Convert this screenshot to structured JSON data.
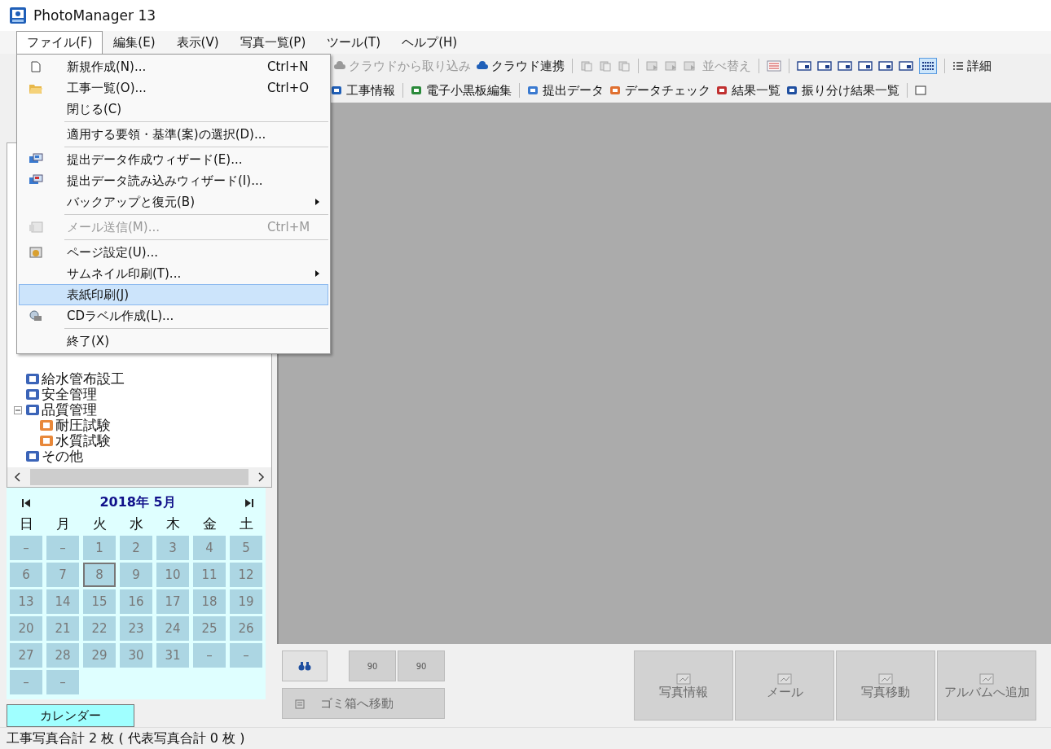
{
  "window": {
    "title": "PhotoManager 13"
  },
  "menubar": [
    {
      "label": "ファイル(F)",
      "selected": true
    },
    {
      "label": "編集(E)",
      "selected": false
    },
    {
      "label": "表示(V)",
      "selected": false
    },
    {
      "label": "写真一覧(P)",
      "selected": false
    },
    {
      "label": "ツール(T)",
      "selected": false
    },
    {
      "label": "ヘルプ(H)",
      "selected": false
    }
  ],
  "file_menu": {
    "groups": [
      [
        {
          "label": "新規作成(N)...",
          "shortcut": "Ctrl+N",
          "disabled": false,
          "selected": false,
          "submenu": false
        },
        {
          "label": "工事一覧(O)...",
          "shortcut": "Ctrl+O",
          "disabled": false,
          "selected": false,
          "submenu": false
        },
        {
          "label": "閉じる(C)",
          "disabled": false,
          "selected": false,
          "submenu": false
        }
      ],
      [
        {
          "label": "適用する要領・基準(案)の選択(D)...",
          "disabled": false,
          "selected": false,
          "submenu": false
        }
      ],
      [
        {
          "label": "提出データ作成ウィザード(E)...",
          "disabled": false,
          "selected": false,
          "submenu": false
        },
        {
          "label": "提出データ読み込みウィザード(I)...",
          "disabled": false,
          "selected": false,
          "submenu": false
        },
        {
          "label": "バックアップと復元(B)",
          "disabled": false,
          "selected": false,
          "submenu": true
        }
      ],
      [
        {
          "label": "メール送信(M)...",
          "shortcut": "Ctrl+M",
          "disabled": true,
          "selected": false,
          "submenu": false
        }
      ],
      [
        {
          "label": "ページ設定(U)...",
          "disabled": false,
          "selected": false,
          "submenu": false
        },
        {
          "label": "サムネイル印刷(T)...",
          "disabled": false,
          "selected": false,
          "submenu": true
        },
        {
          "label": "表紙印刷(J)",
          "disabled": false,
          "selected": true,
          "submenu": false
        },
        {
          "label": "CDラベル作成(L)...",
          "disabled": false,
          "selected": false,
          "submenu": false
        }
      ],
      [
        {
          "label": "終了(X)",
          "disabled": false,
          "selected": false,
          "submenu": false
        }
      ]
    ]
  },
  "toolbar_1": [
    {
      "label": "クラウドから取り込み",
      "disabled": true
    },
    {
      "label": "クラウド連携",
      "disabled": false
    },
    {
      "label": "並べ替え",
      "disabled": true
    },
    {
      "label": "詳細",
      "disabled": false
    }
  ],
  "toolbar_2": [
    {
      "label": "工事情報"
    },
    {
      "label": "電子小黒板編集"
    },
    {
      "label": "提出データ"
    },
    {
      "label": "データチェック"
    },
    {
      "label": "結果一覧"
    },
    {
      "label": "振り分け結果一覧"
    }
  ],
  "tree": [
    {
      "label": "給水管布設工",
      "color": "#3b64b8"
    },
    {
      "label": "安全管理",
      "color": "#3b64b8"
    },
    {
      "label": "品質管理",
      "color": "#3b64b8",
      "expanded": true,
      "children": [
        {
          "label": "耐圧試験",
          "color": "#e8883a"
        },
        {
          "label": "水質試験",
          "color": "#e8883a"
        }
      ]
    },
    {
      "label": "その他",
      "color": "#3b64b8"
    }
  ],
  "calendar": {
    "title": "2018年 5月",
    "weekdays": [
      "日",
      "月",
      "火",
      "水",
      "木",
      "金",
      "土"
    ],
    "days": [
      {
        "label": "–",
        "selected": false
      },
      {
        "label": "–",
        "selected": false
      },
      {
        "label": "1",
        "selected": false
      },
      {
        "label": "2",
        "selected": false
      },
      {
        "label": "3",
        "selected": false
      },
      {
        "label": "4",
        "selected": false
      },
      {
        "label": "5",
        "selected": false
      },
      {
        "label": "6",
        "selected": false
      },
      {
        "label": "7",
        "selected": false
      },
      {
        "label": "8",
        "selected": true
      },
      {
        "label": "9",
        "selected": false
      },
      {
        "label": "10",
        "selected": false
      },
      {
        "label": "11",
        "selected": false
      },
      {
        "label": "12",
        "selected": false
      },
      {
        "label": "13",
        "selected": false
      },
      {
        "label": "14",
        "selected": false
      },
      {
        "label": "15",
        "selected": false
      },
      {
        "label": "16",
        "selected": false
      },
      {
        "label": "17",
        "selected": false
      },
      {
        "label": "18",
        "selected": false
      },
      {
        "label": "19",
        "selected": false
      },
      {
        "label": "20",
        "selected": false
      },
      {
        "label": "21",
        "selected": false
      },
      {
        "label": "22",
        "selected": false
      },
      {
        "label": "23",
        "selected": false
      },
      {
        "label": "24",
        "selected": false
      },
      {
        "label": "25",
        "selected": false
      },
      {
        "label": "26",
        "selected": false
      },
      {
        "label": "27",
        "selected": false
      },
      {
        "label": "28",
        "selected": false
      },
      {
        "label": "29",
        "selected": false
      },
      {
        "label": "30",
        "selected": false
      },
      {
        "label": "31",
        "selected": false
      },
      {
        "label": "–",
        "selected": false
      },
      {
        "label": "–",
        "selected": false
      },
      {
        "label": "–",
        "selected": false
      },
      {
        "label": "–",
        "selected": false
      }
    ],
    "tab": "カレンダー"
  },
  "rotate_buttons": [
    {
      "label": "90"
    },
    {
      "label": "90"
    }
  ],
  "trash_button": {
    "label": "ゴミ箱へ移動",
    "disabled": true
  },
  "action_buttons": [
    {
      "label": "写真情報",
      "disabled": true
    },
    {
      "label": "メール",
      "disabled": true
    },
    {
      "label": "写真移動",
      "disabled": true
    },
    {
      "label": "アルバムへ追加",
      "disabled": true
    }
  ],
  "status_bar": "工事写真合計 2 枚 ( 代表写真合計 0 枚 )"
}
